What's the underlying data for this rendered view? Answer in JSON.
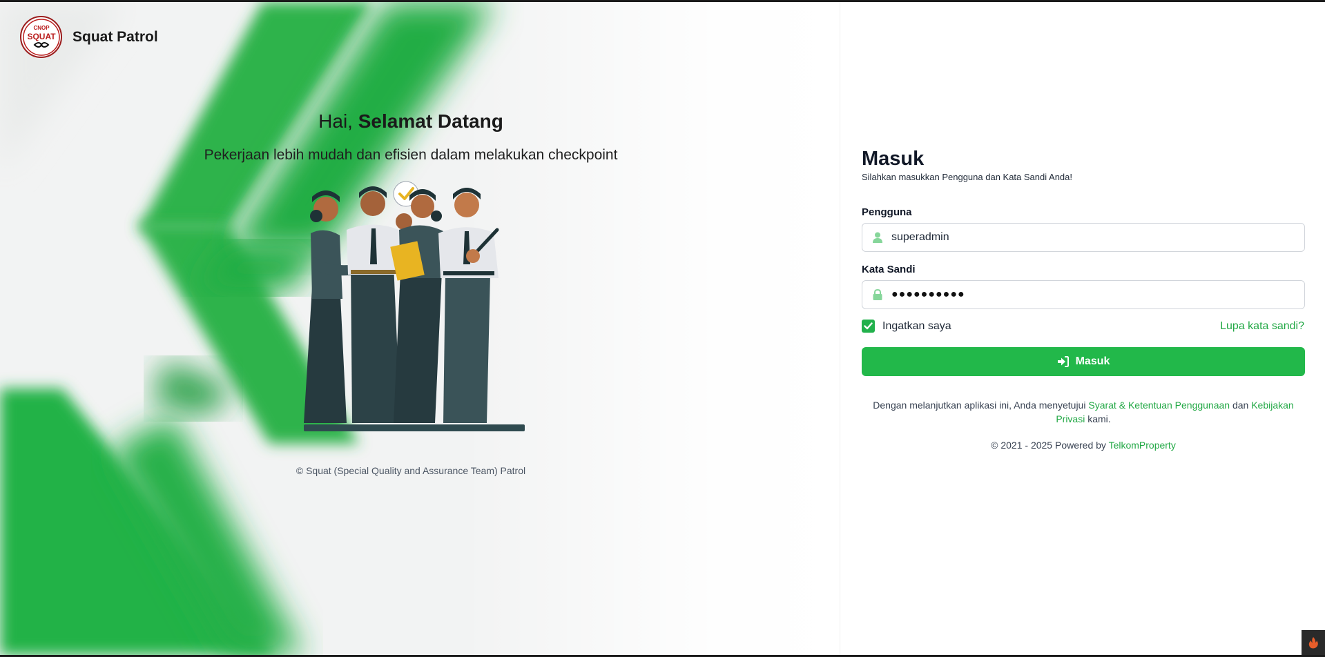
{
  "brand": {
    "name": "Squat Patrol",
    "logo_text_top": "CNOP",
    "logo_text_main": "SQUAT"
  },
  "hero": {
    "greeting_prefix": "Hai,",
    "greeting_bold": "Selamat Datang",
    "subtitle": "Pekerjaan lebih mudah dan efisien dalam melakukan checkpoint",
    "illustration": "security-team-illustration",
    "copyright": "© Squat (Special Quality and Assurance Team) Patrol"
  },
  "login": {
    "title": "Masuk",
    "subtitle": "Silahkan masukkan Pengguna dan Kata Sandi Anda!",
    "username_label": "Pengguna",
    "username_value": "superadmin",
    "username_icon": "user-icon",
    "password_label": "Kata Sandi",
    "password_value": "●●●●●●●●●●",
    "password_icon": "lock-icon",
    "remember_label": "Ingatkan saya",
    "remember_checked": true,
    "forgot_label": "Lupa kata sandi?",
    "submit_label": "Masuk",
    "submit_icon": "sign-in-icon"
  },
  "terms": {
    "prefix": "Dengan melanjutkan aplikasi ini, Anda menyetujui",
    "terms_link": "Syarat & Ketentuan Penggunaan",
    "connector": "dan",
    "privacy_link": "Kebijakan Privasi",
    "suffix": "kami."
  },
  "footer": {
    "powered_prefix": "© 2021 - 2025 Powered by",
    "powered_link": "TelkomProperty"
  },
  "colors": {
    "accent": "#22b84a",
    "link": "#22a845",
    "text": "#1f2937"
  }
}
